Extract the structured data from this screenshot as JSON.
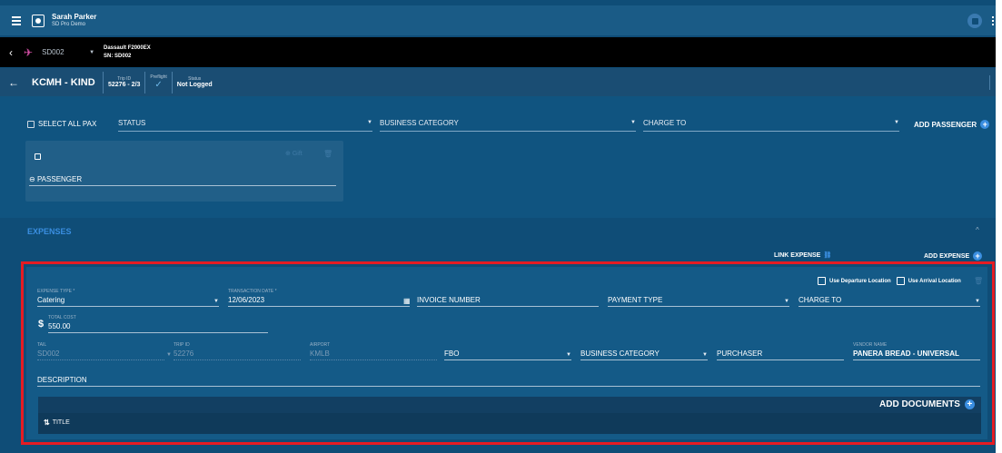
{
  "header": {
    "user_name": "Sarah Parker",
    "org_name": "SD Pro Demo"
  },
  "aircraft": {
    "tail": "SD002",
    "model": "Dassault F2000EX",
    "serial": "SN: SD002"
  },
  "trip": {
    "route": "KCMH - KIND",
    "trip_id_label": "Trip ID",
    "trip_id": "52276 - 2/3",
    "preflight_label": "Preflight",
    "status_label": "Status",
    "status": "Not Logged"
  },
  "passengers": {
    "select_all": "SELECT ALL PAX",
    "status_placeholder": "STATUS",
    "business_category_placeholder": "BUSINESS CATEGORY",
    "charge_to_placeholder": "CHARGE TO",
    "add_passenger": "ADD PASSENGER",
    "card": {
      "action_label": "Gift",
      "passenger_field": "PASSENGER"
    }
  },
  "expenses": {
    "title": "EXPENSES",
    "link_expense": "LINK EXPENSE",
    "add_expense": "ADD EXPENSE",
    "use_departure": "Use Departure Location",
    "use_arrival": "Use Arrival Location",
    "expense_type_label": "EXPENSE TYPE *",
    "expense_type": "Catering",
    "transaction_date_label": "TRANSACTION DATE *",
    "transaction_date": "12/06/2023",
    "invoice_number": "INVOICE NUMBER",
    "payment_type": "PAYMENT TYPE",
    "charge_to": "CHARGE TO",
    "total_cost_label": "TOTAL COST",
    "total_cost": "550.00",
    "tail_label": "TAIL",
    "tail": "SD002",
    "trip_id_label": "TRIP ID",
    "trip_id": "52276",
    "airport_label": "AIRPORT",
    "airport": "KMLB",
    "fbo": "FBO",
    "business_category": "BUSINESS CATEGORY",
    "purchaser": "PURCHASER",
    "vendor_name_label": "VENDOR NAME",
    "vendor_name": "PANERA BREAD - UNIVERSAL",
    "description": "DESCRIPTION",
    "add_documents": "ADD DOCUMENTS",
    "docs_column_title": "TITLE"
  },
  "colors": {
    "accent": "#3a8ee0",
    "highlight_frame": "#e51c23",
    "background": "#0f4d77"
  }
}
